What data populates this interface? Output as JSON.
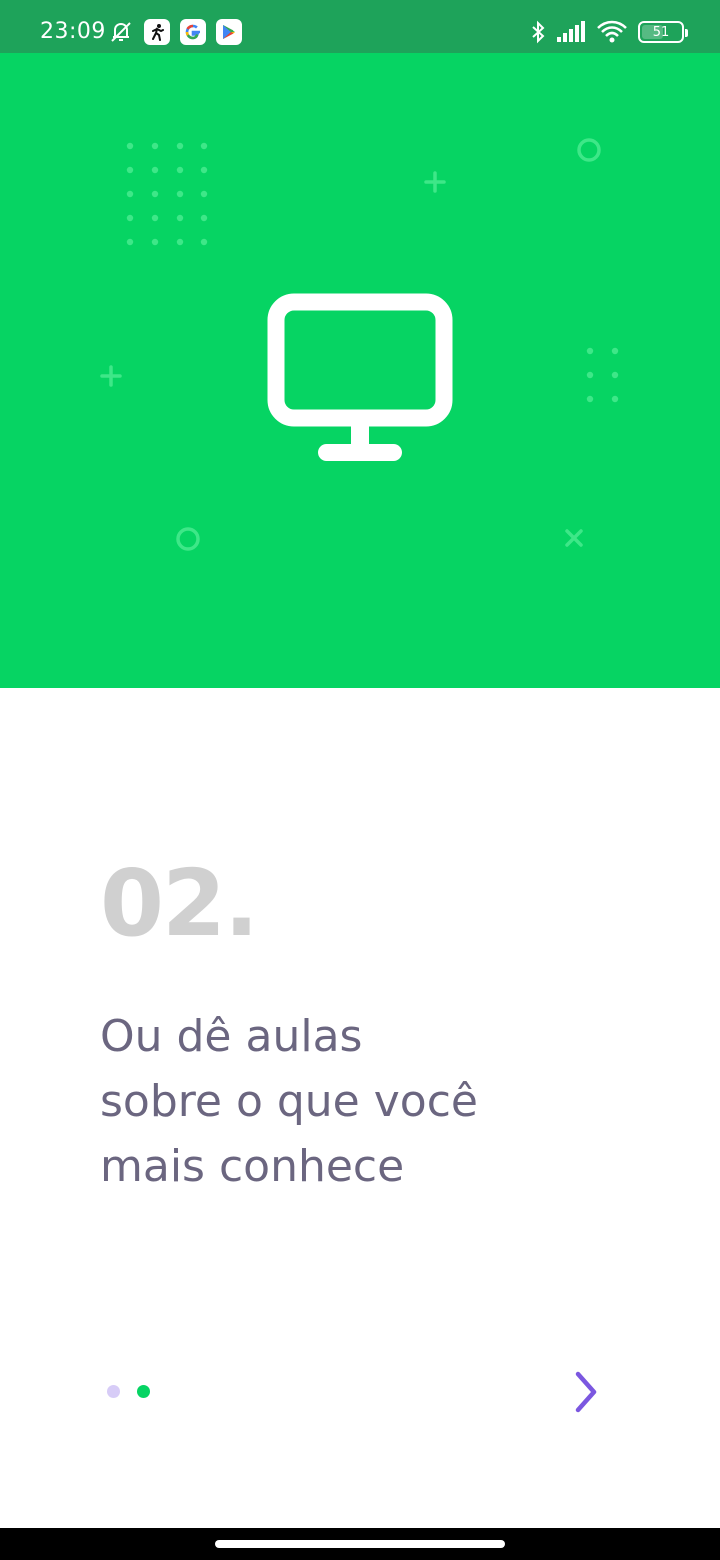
{
  "status_bar": {
    "time": "23:09",
    "battery_level": "51",
    "left_icons": [
      "bell-off-icon",
      "runner-app-icon",
      "google-icon",
      "play-store-icon"
    ],
    "right_icons": [
      "bluetooth-icon",
      "signal-icon",
      "wifi-icon",
      "battery-icon"
    ]
  },
  "hero": {
    "background_color": "#06d463",
    "icon": "monitor-icon",
    "decorations": [
      "dot-grid",
      "plus",
      "ring",
      "cross"
    ]
  },
  "onboarding": {
    "step_number": "02.",
    "lines": [
      "Ou dê aulas",
      "sobre o que você",
      "mais conhece"
    ],
    "page_count": 2,
    "active_page": 2
  },
  "colors": {
    "accent_green": "#06d463",
    "text_muted": "#6b6680",
    "number_gray": "#d0d0d0",
    "purple": "#7b57e0",
    "dot_inactive": "#d7ccf7"
  },
  "controls": {
    "next_icon": "chevron-right-icon"
  }
}
